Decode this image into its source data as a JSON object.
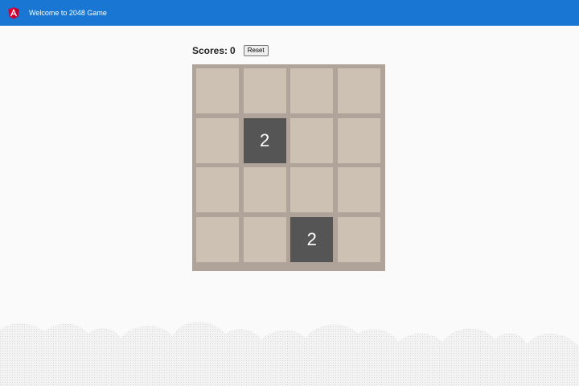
{
  "toolbar": {
    "title": "Welcome to 2048 Game",
    "logo_icon": "angular-logo-icon",
    "background_color": "#1976d2"
  },
  "score": {
    "label": "Scores:",
    "value": "0",
    "reset_label": "Reset"
  },
  "board": {
    "grid_size": 4,
    "tiles": [
      [
        "",
        "",
        "",
        ""
      ],
      [
        "",
        "2",
        "",
        ""
      ],
      [
        "",
        "",
        "",
        ""
      ],
      [
        "",
        "",
        "2",
        ""
      ]
    ],
    "board_color": "#b0a39a",
    "empty_color": "#cdc1b4",
    "tile_color": "#555555"
  }
}
